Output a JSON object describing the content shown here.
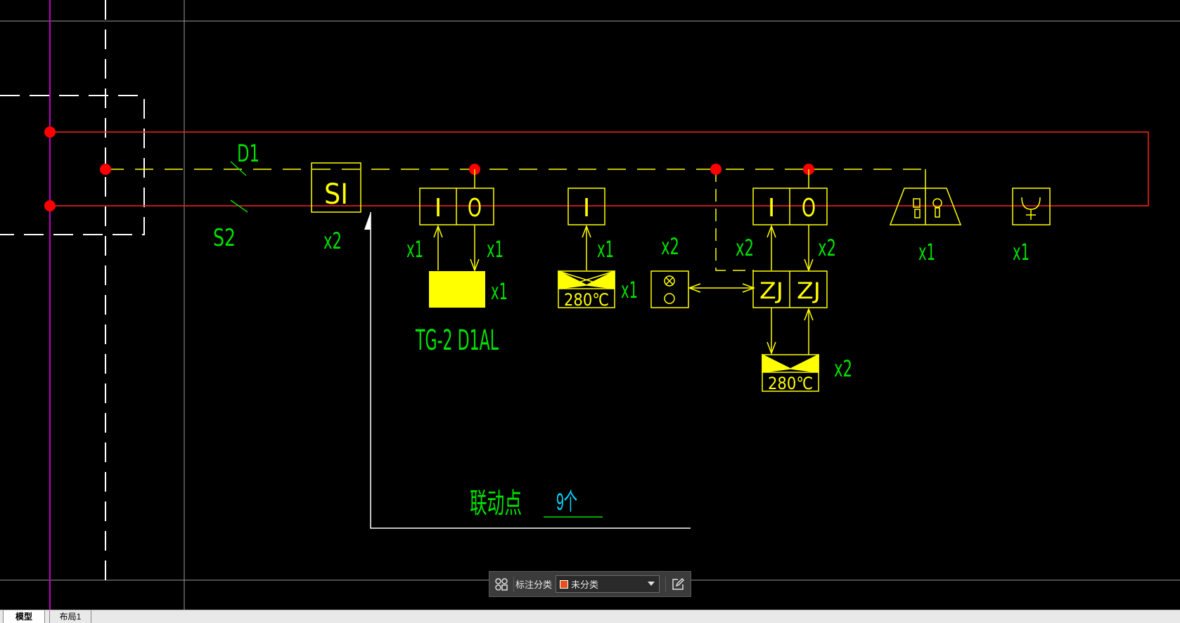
{
  "drawing": {
    "labels": {
      "d1": "D1",
      "s2": "S2",
      "si_box": "SI",
      "si_qty": "x2",
      "io1_i": "I",
      "io1_o": "O",
      "io1_qty_in": "x1",
      "io1_qty_out": "x1",
      "yellow_box_qty": "x1",
      "model_name": "TG-2 D1AL",
      "i_box": "I",
      "i_box_qty": "x1",
      "damper1_temp": "280℃",
      "damper1_qty": "x1",
      "bell_qty": "x2",
      "io2_i": "I",
      "io2_o": "O",
      "io2_qty_in": "x2",
      "io2_qty_out": "x2",
      "zj_left": "ZJ",
      "zj_right": "ZJ",
      "damper2_temp": "280℃",
      "damper2_qty": "x2",
      "alarm_qty": "x1",
      "phone_qty": "x1",
      "linkage_label": "联动点",
      "linkage_value": "9个"
    },
    "colors": {
      "text": "#00e000",
      "symbol": "#ffff00",
      "bus": "#ff2020",
      "node": "#ff0000",
      "dash": "#ffffff",
      "axis": "#c000c0",
      "cyan": "#00d8ff"
    }
  },
  "toolbar": {
    "group_icon": "grid-icon",
    "label": "标注分类",
    "select_value": "未分类",
    "select_swatch": "#e8501c",
    "edit_icon": "edit-icon"
  },
  "tabs": [
    {
      "label": "模型",
      "active": true
    },
    {
      "label": "布局1",
      "active": false
    }
  ]
}
